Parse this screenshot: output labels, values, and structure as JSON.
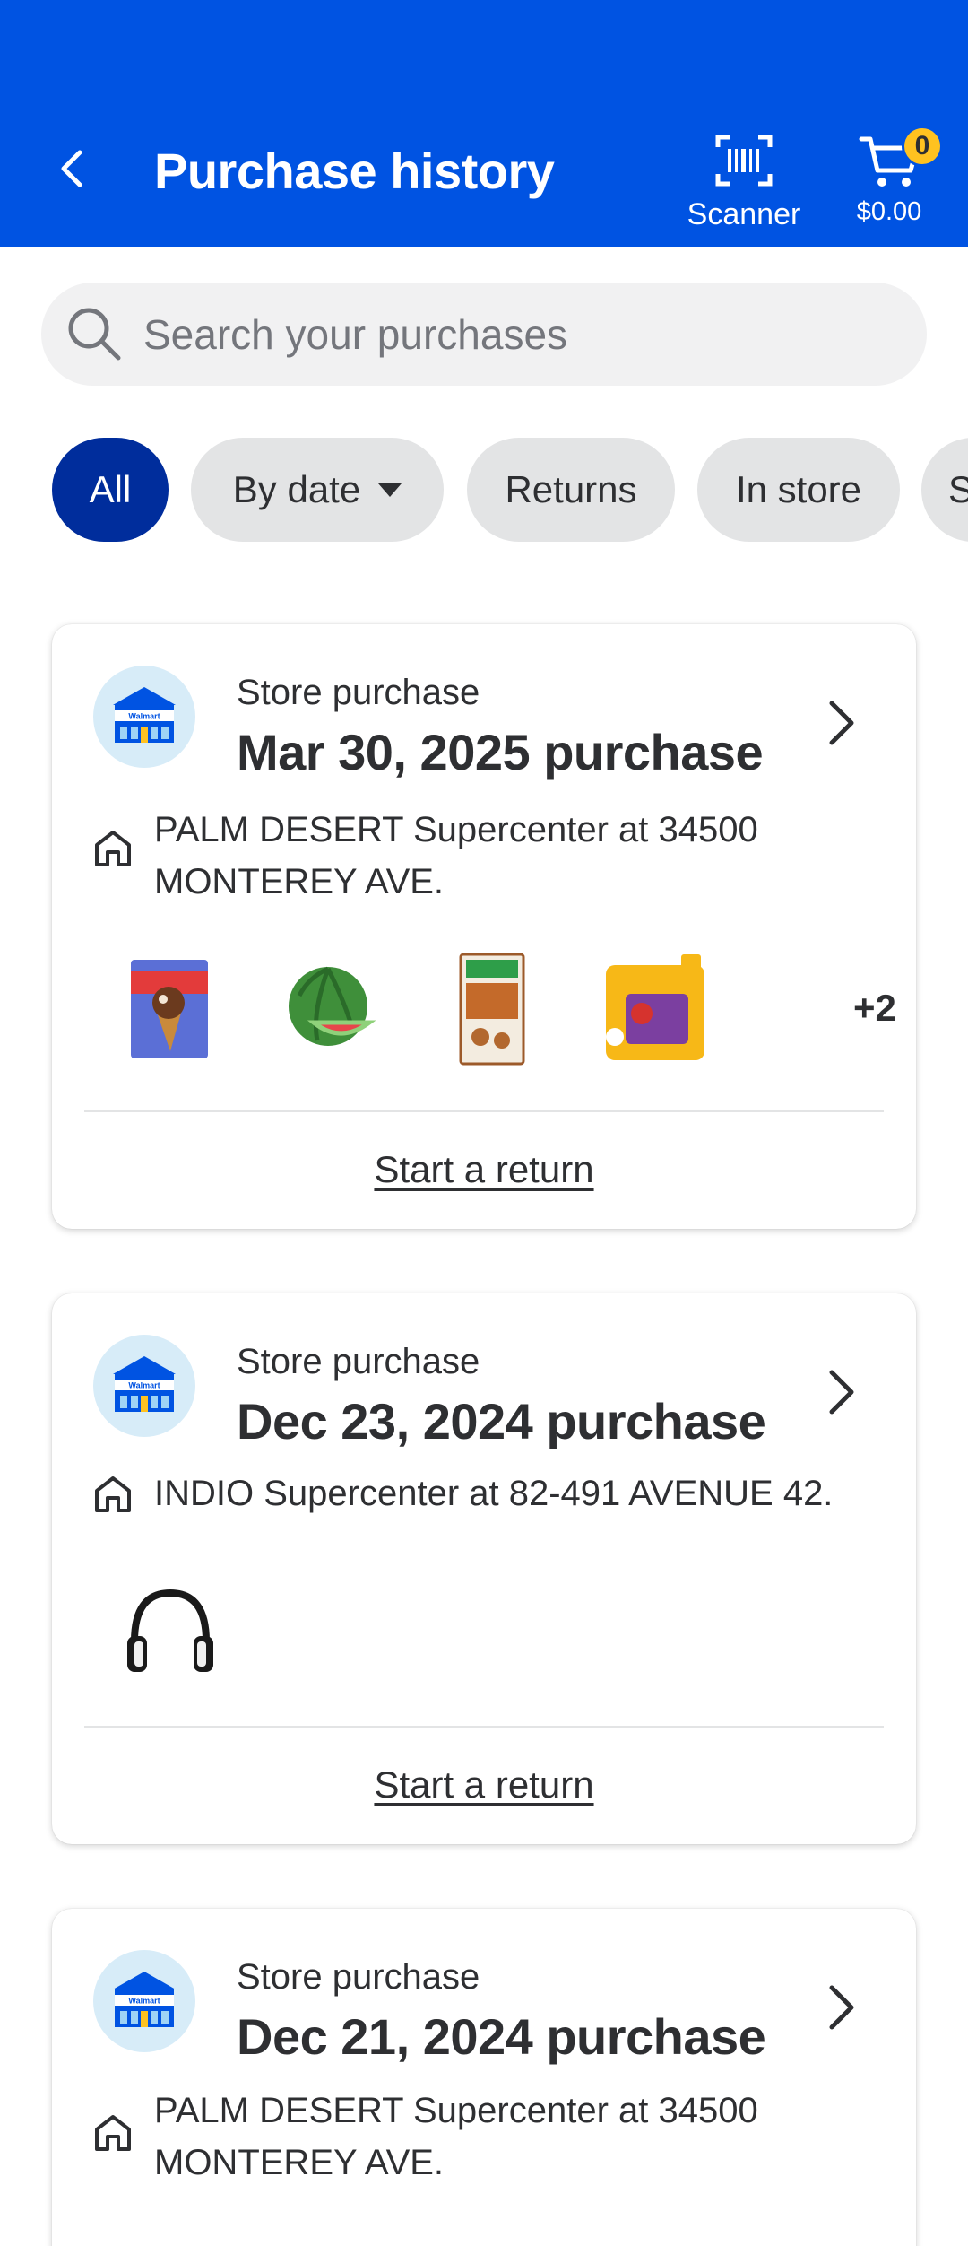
{
  "header": {
    "title": "Purchase history",
    "scanner_label": "Scanner",
    "cart_count": "0",
    "cart_total": "$0.00",
    "colors": {
      "brand_blue": "#0053e2",
      "badge_yellow": "#ffc220"
    }
  },
  "search": {
    "placeholder": "Search your purchases"
  },
  "filters": [
    {
      "label": "All",
      "active": true
    },
    {
      "label": "By date",
      "dropdown": true
    },
    {
      "label": "Returns"
    },
    {
      "label": "In store"
    },
    {
      "label": "S"
    }
  ],
  "purchases": [
    {
      "kind": "Store purchase",
      "date_label": "Mar 30, 2025 purchase",
      "store": "PALM DESERT Supercenter at 34500 MONTEREY AVE.",
      "items": [
        "drumstick-ice-cream",
        "watermelon",
        "cinnamon-toast-crunch-cereal",
        "arm-hammer-detergent"
      ],
      "more_count": "+2",
      "action": "Start a return"
    },
    {
      "kind": "Store purchase",
      "date_label": "Dec 23, 2024 purchase",
      "store": "INDIO Supercenter at 82-491 AVENUE 42.",
      "items": [
        "headphones"
      ],
      "action": "Start a return"
    },
    {
      "kind": "Store purchase",
      "date_label": "Dec 21, 2024 purchase",
      "store": "PALM DESERT Supercenter at 34500 MONTEREY AVE."
    }
  ],
  "store_logo_text": "Walmart"
}
